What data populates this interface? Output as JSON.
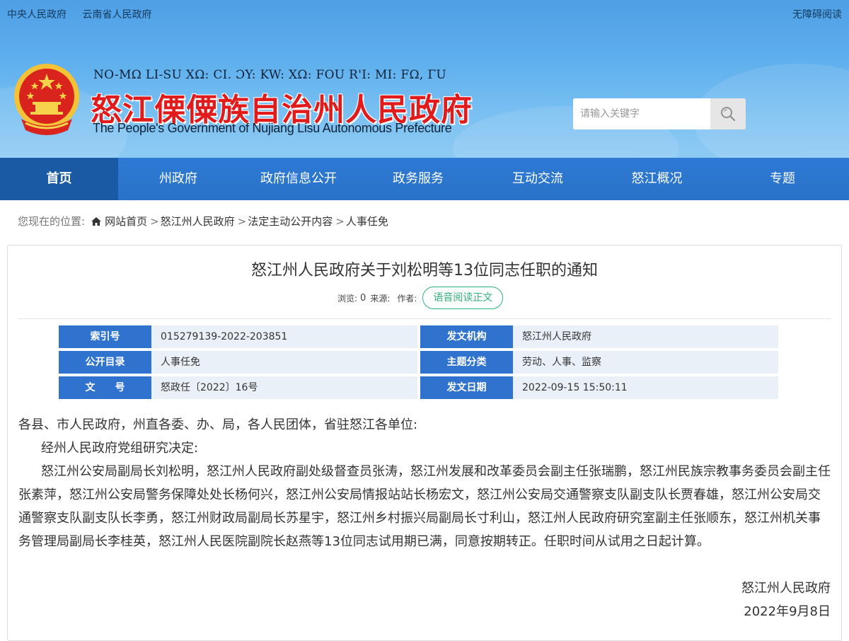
{
  "top_links": [
    "中央人民政府",
    "云南省人民政府"
  ],
  "accessibility_label": "无障碍阅读",
  "brand": {
    "lisu_name": "NO-MΩ LI-SU XΩ: CI. ƆY: KW: XΩ: FOU R'I: MI: FΩ, ΓU",
    "title": "怒江傈僳族自治州人民政府",
    "english": "The People's Government of Nujiang Lisu Autonomous Prefecture"
  },
  "search": {
    "placeholder": "请输入关键字",
    "icon": "search-icon"
  },
  "nav": [
    {
      "label": "首页",
      "active": true
    },
    {
      "label": "州政府",
      "active": false
    },
    {
      "label": "政府信息公开",
      "active": false
    },
    {
      "label": "政务服务",
      "active": false
    },
    {
      "label": "互动交流",
      "active": false
    },
    {
      "label": "怒江概况",
      "active": false
    },
    {
      "label": "专题",
      "active": false
    }
  ],
  "breadcrumb": {
    "label": "您现在的位置:",
    "items": [
      "网站首页",
      "怒江州人民政府",
      "法定主动公开内容",
      "人事任免"
    ],
    "separator": ">"
  },
  "article": {
    "title": "怒江州人民政府关于刘松明等13位同志任职的通知",
    "views_label": "浏览:",
    "views": "0",
    "source_label": "来源:",
    "author_label": "作者:",
    "voice_button": "语音阅读正文",
    "info": [
      {
        "label": "索引号",
        "value": "015279139-2022-203851",
        "label2": "发文机构",
        "value2": "怒江州人民政府"
      },
      {
        "label": "公开目录",
        "value": "人事任免",
        "label2": "主题分类",
        "value2": "劳动、人事、监察"
      },
      {
        "label": "文　　号",
        "value": "怒政任〔2022〕16号",
        "label2": "发文日期",
        "value2": "2022-09-15 15:50:11"
      }
    ],
    "salutation": "各县、市人民政府，州直各委、办、局，各人民团体，省驻怒江各单位:",
    "decision": "经州人民政府党组研究决定:",
    "content": "怒江州公安局副局长刘松明，怒江州人民政府副处级督查员张涛，怒江州发展和改革委员会副主任张瑞鹏，怒江州民族宗教事务委员会副主任张素萍，怒江州公安局警务保障处处长杨何兴，怒江州公安局情报站站长杨宏文，怒江州公安局交通警察支队副支队长贾春雄，怒江州公安局交通警察支队副支队长李勇，怒江州财政局副局长苏星宇，怒江州乡村振兴局副局长寸利山，怒江州人民政府研究室副主任张顺东，怒江州机关事务管理局副局长李桂英，怒江州人民医院副院长赵燕等13位同志试用期已满，同意按期转正。任职时间从试用之日起计算。",
    "signature": "怒江州人民政府",
    "date": "2022年9月8日"
  },
  "colors": {
    "nav_bg": "#2a72c9",
    "nav_active": "#1a5aa4",
    "brand_red": "#e11b1b",
    "label_blue": "#2f73cf",
    "voice_green": "#2fb27a"
  }
}
